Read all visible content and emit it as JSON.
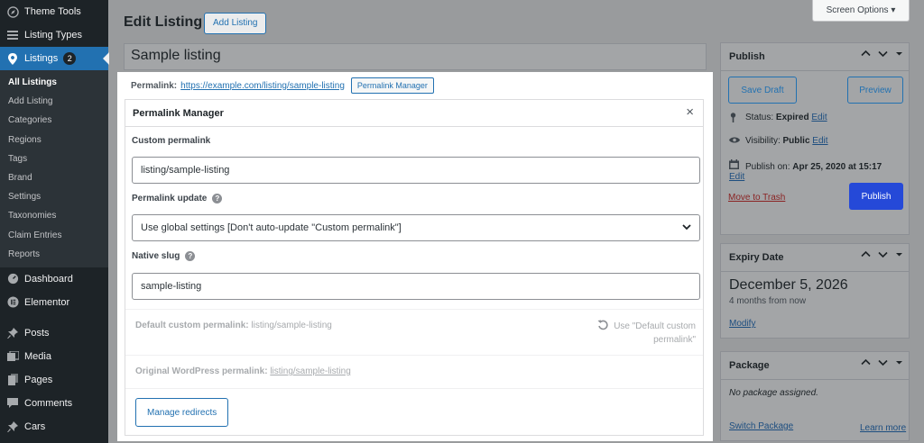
{
  "sidebar": {
    "top_items": [
      {
        "label": "Theme Tools",
        "icon": "compass-icon"
      },
      {
        "label": "Listing Types",
        "icon": "list-icon"
      }
    ],
    "active": {
      "label": "Listings",
      "badge": "2",
      "icon": "location-pin-icon"
    },
    "submenu": [
      "All Listings",
      "Add Listing",
      "Categories",
      "Regions",
      "Tags",
      "Brand",
      "Settings",
      "Taxonomies",
      "Claim Entries",
      "Reports"
    ],
    "bottom_items": [
      {
        "label": "Dashboard",
        "icon": "dashboard-icon"
      },
      {
        "label": "Elementor",
        "icon": "elementor-icon"
      },
      {
        "label": "Posts",
        "icon": "pin-icon"
      },
      {
        "label": "Media",
        "icon": "media-icon"
      },
      {
        "label": "Pages",
        "icon": "pages-icon"
      },
      {
        "label": "Comments",
        "icon": "comment-icon"
      },
      {
        "label": "Cars",
        "icon": "pin-icon"
      }
    ]
  },
  "header": {
    "title": "Edit Listing",
    "add_button": "Add Listing",
    "screen_options": "Screen Options ▾"
  },
  "post_title": "Sample listing",
  "permalink": {
    "label": "Permalink:",
    "url": "https://example.com/listing/sample-listing",
    "manager_button": "Permalink Manager"
  },
  "permalink_manager": {
    "title": "Permalink Manager",
    "close": "×",
    "custom_permalink_label": "Custom permalink",
    "custom_permalink_value": "listing/sample-listing",
    "update_label": "Permalink update",
    "update_value": "Use global settings [Don't auto-update \"Custom permalink\"]",
    "native_slug_label": "Native slug",
    "native_slug_value": "sample-listing",
    "default_label": "Default custom permalink:",
    "default_value": "listing/sample-listing",
    "use_default": "Use \"Default custom permalink\"",
    "original_label": "Original WordPress permalink:",
    "original_value": "listing/sample-listing",
    "manage_redirects": "Manage redirects"
  },
  "publish_box": {
    "title": "Publish",
    "save_draft": "Save Draft",
    "preview": "Preview",
    "status_label": "Status:",
    "status_value": "Expired",
    "visibility_label": "Visibility:",
    "visibility_value": "Public",
    "publish_on_label": "Publish on:",
    "publish_on_value": "Apr 25, 2020 at 15:17",
    "edit": "Edit",
    "move_to_trash": "Move to Trash",
    "publish_button": "Publish"
  },
  "expiry_box": {
    "title": "Expiry Date",
    "date": "December 5, 2026",
    "relative": "4 months from now",
    "modify": "Modify"
  },
  "package_box": {
    "title": "Package",
    "no_package": "No package assigned.",
    "switch": "Switch Package",
    "learn_more": "Learn more"
  },
  "colors": {
    "accent": "#2271b1",
    "sidebar_bg": "#1d2327",
    "publish_button": "#2549d8"
  }
}
